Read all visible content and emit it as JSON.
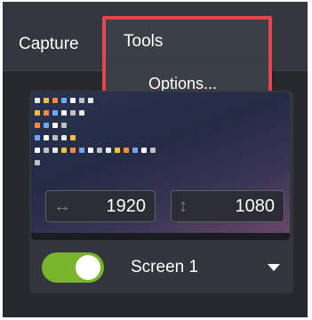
{
  "menubar": {
    "capture_label": "Capture",
    "tools_label": "Tools"
  },
  "tools_menu": {
    "items": [
      {
        "label": "Options..."
      }
    ]
  },
  "recording_area": {
    "width": "1920",
    "height": "1080",
    "width_icon": "arrows-horizontal-icon",
    "height_icon": "arrows-vertical-icon"
  },
  "screen_select": {
    "toggle_on": true,
    "label": "Screen 1"
  },
  "colors": {
    "accent_toggle": "#78b52a",
    "highlight_border": "#e2474d",
    "background": "#26292e"
  }
}
